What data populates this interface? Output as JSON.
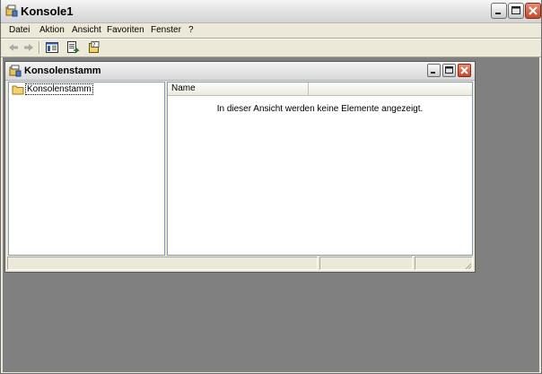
{
  "app": {
    "title": "Konsole1"
  },
  "menu": [
    {
      "label": "Datei"
    },
    {
      "label": "Aktion"
    },
    {
      "label": "Ansicht"
    },
    {
      "label": "Favoriten"
    },
    {
      "label": "Fenster"
    },
    {
      "label": "?"
    }
  ],
  "toolbar": {
    "buttons": [
      "back-icon",
      "forward-icon",
      "show-hide-console-tree-icon",
      "export-list-icon",
      "help-icon"
    ]
  },
  "child_window": {
    "title": "Konsolenstamm",
    "tree": {
      "root_label": "Konsolenstamm"
    },
    "list": {
      "columns": [
        "Name",
        ""
      ],
      "empty_message": "In dieser Ansicht werden keine Elemente angezeigt."
    }
  },
  "colors": {
    "desktop": "#808080",
    "chrome": "#ece9d8",
    "close_button": "#c44a2c"
  }
}
